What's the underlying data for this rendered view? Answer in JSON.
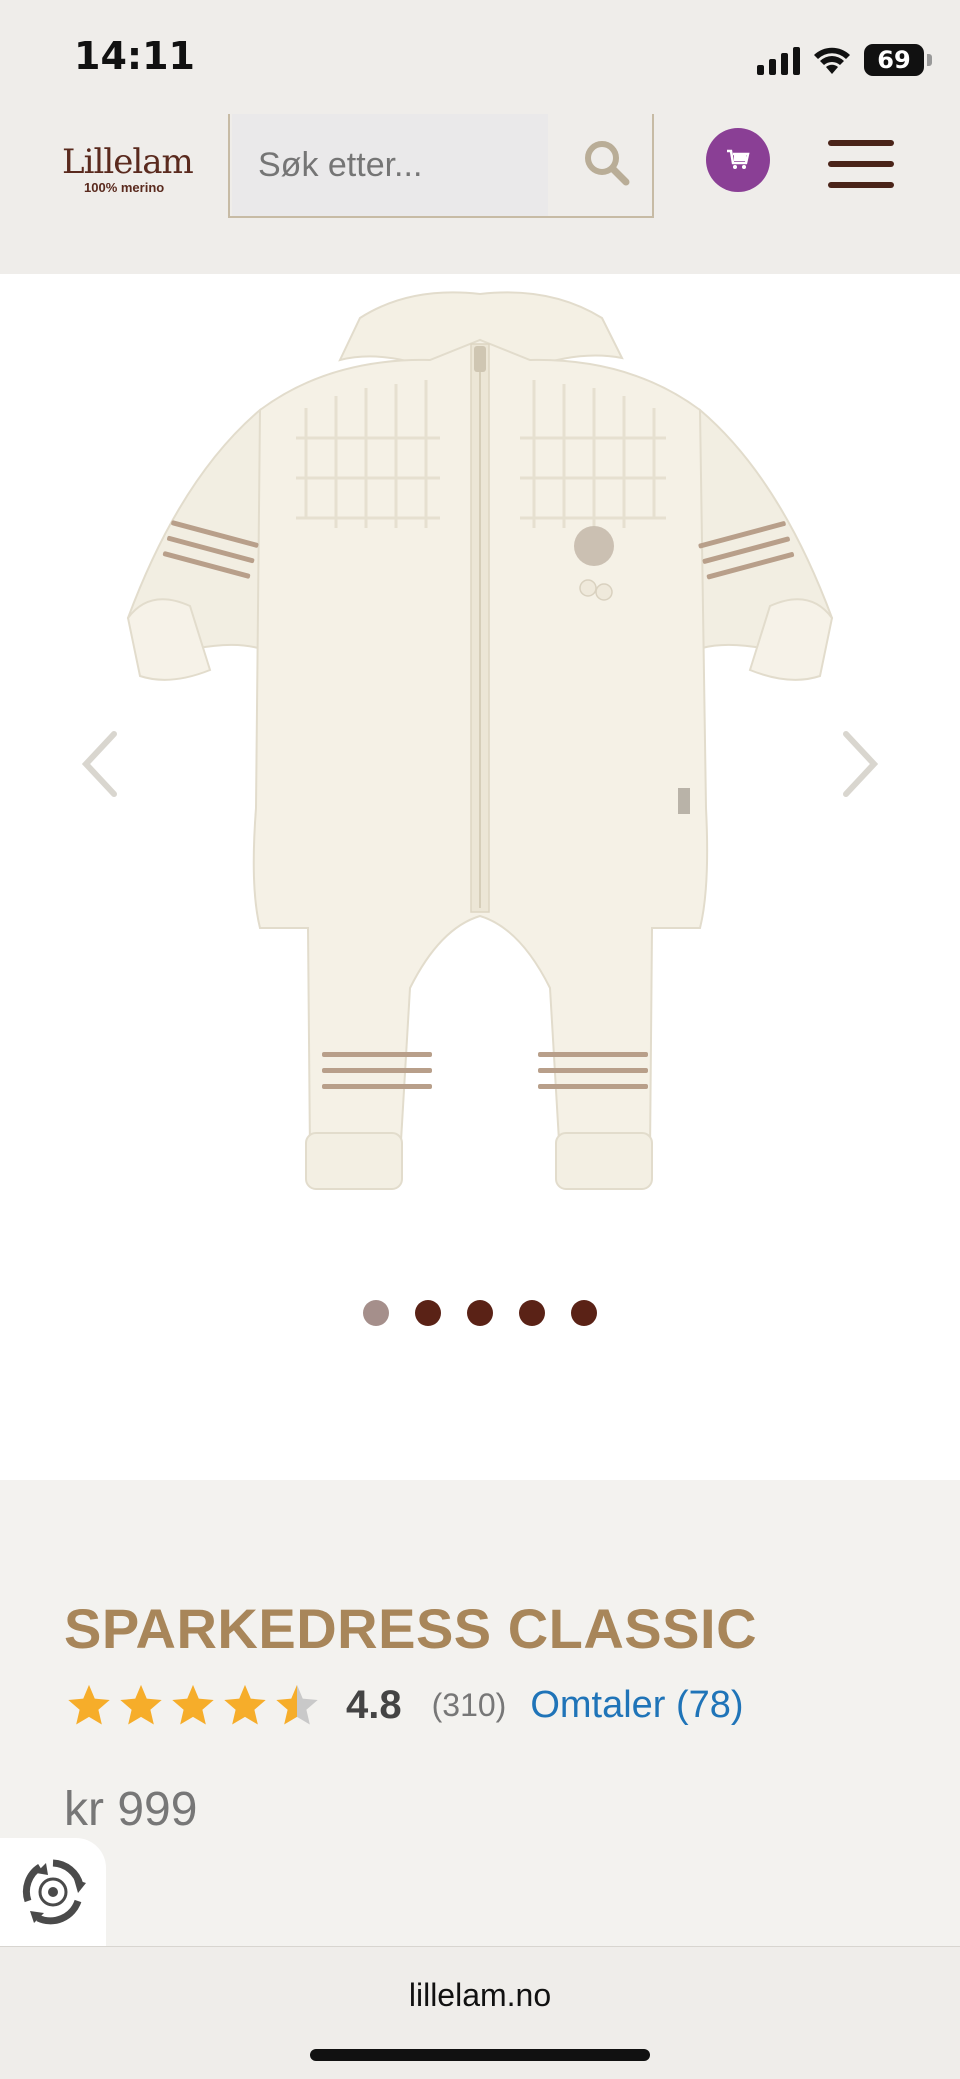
{
  "status_bar": {
    "time": "14:11",
    "battery": "69",
    "icons": [
      "signal-icon",
      "wifi-icon",
      "battery-icon"
    ]
  },
  "header": {
    "logo_name": "Lillelam",
    "logo_tagline": "100% merino",
    "search_placeholder": "Søk etter...",
    "icons": [
      "search-icon",
      "cart-icon",
      "menu-icon"
    ],
    "cart_color": "#8a3f95"
  },
  "gallery": {
    "dot_count": 5,
    "active_index": 0,
    "icons": [
      "chevron-left-icon",
      "chevron-right-icon"
    ]
  },
  "product": {
    "title": "SPARKEDRESS CLASSIC",
    "rating": "4.8",
    "rating_count": "(310)",
    "reviews_link": "Omtaler (78)",
    "stars_value": 4.5,
    "price": "kr 999",
    "title_color": "#a8865a",
    "link_color": "#1f74b8"
  },
  "browser": {
    "url": "lillelam.no"
  }
}
